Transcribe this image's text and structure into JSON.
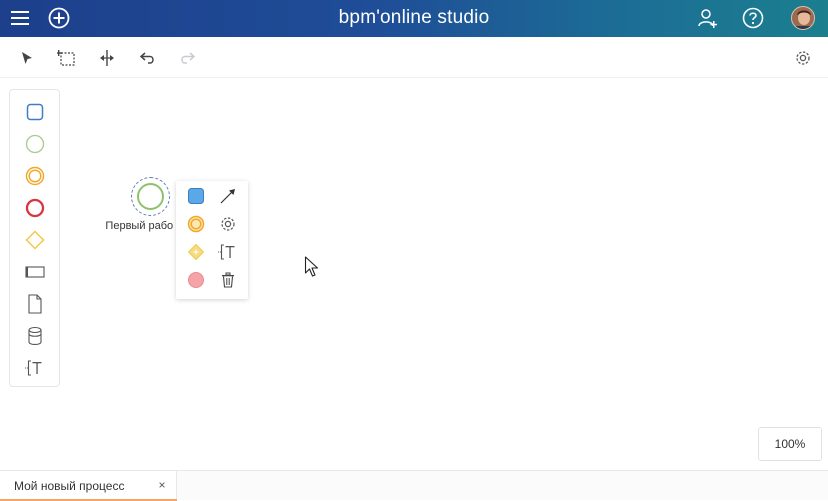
{
  "header": {
    "title": "bpm'online studio",
    "menu_icon": "hamburger-menu-icon",
    "add_icon": "add-circle-icon",
    "add_user_icon": "add-user-icon",
    "help_icon": "help-icon",
    "avatar": "user-avatar"
  },
  "toolbar": {
    "tools": [
      "select-pointer-icon",
      "lasso-select-icon",
      "space-tool-icon",
      "undo-icon",
      "redo-icon"
    ],
    "settings_icon": "gear-icon"
  },
  "palette": {
    "items": [
      "task-rounded-rectangle-icon",
      "start-event-circle-icon",
      "intermediate-event-double-circle-icon",
      "end-event-bold-circle-icon",
      "gateway-diamond-icon",
      "subprocess-rectangle-icon",
      "data-object-document-icon",
      "data-store-cylinder-icon",
      "text-annotation-icon"
    ]
  },
  "canvas": {
    "start_event_label": "Первый рабо день"
  },
  "context_menu": {
    "items": [
      "add-task-icon",
      "connect-arrow-icon",
      "add-intermediate-event-icon",
      "settings-gear-icon",
      "add-gateway-icon",
      "annotation-icon",
      "add-end-event-icon",
      "trash-icon"
    ]
  },
  "zoom": {
    "value": "100%"
  },
  "tabs": [
    {
      "label": "Мой новый процесс",
      "close": "×"
    }
  ],
  "colors": {
    "header_start": "#1d3f8c",
    "header_end": "#1b7f8e",
    "task_blue": "#5aa9e6",
    "start_green": "#8fc16b",
    "intermediate_orange": "#f0a92b",
    "end_red": "#d9363e",
    "gateway_yellow": "#f2c94c",
    "tab_accent": "#f4a36a"
  }
}
